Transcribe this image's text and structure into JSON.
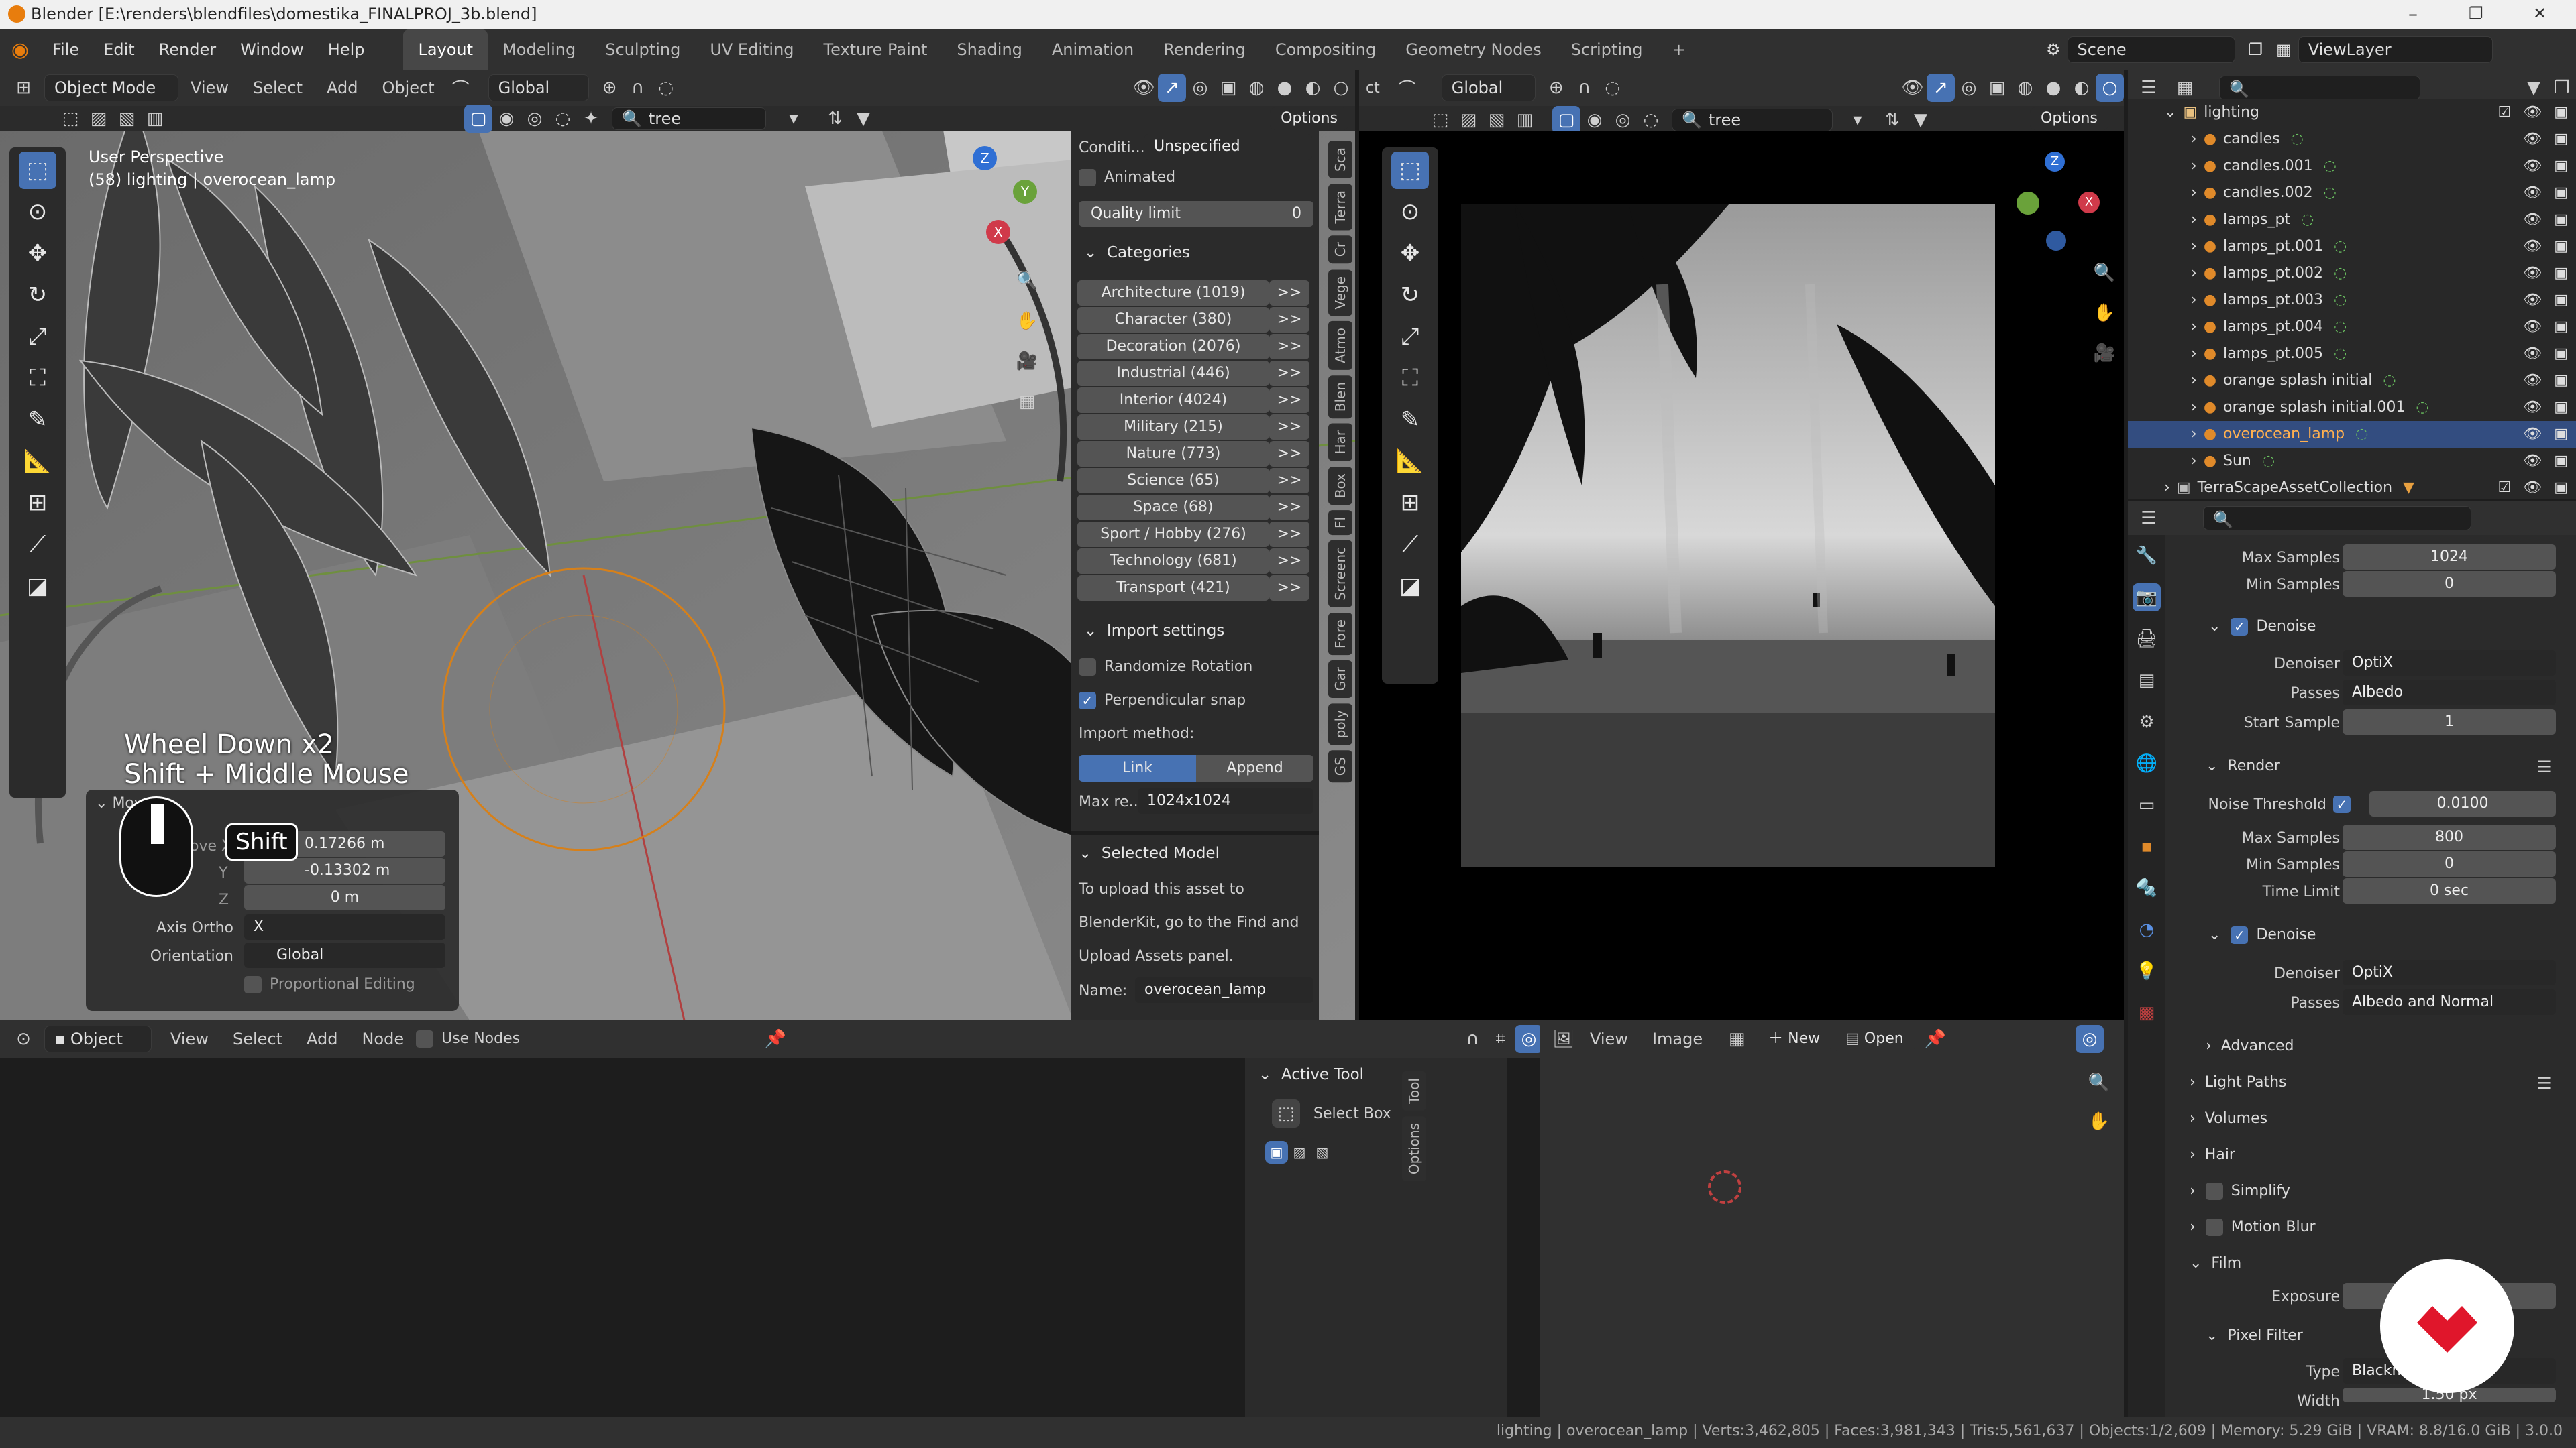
{
  "window": {
    "title": "Blender [E:\\renders\\blendfiles\\domestika_FINALPROJ_3b.blend]",
    "controls": [
      "–",
      "❐",
      "✕"
    ]
  },
  "menubar": {
    "menus": [
      "File",
      "Edit",
      "Render",
      "Window",
      "Help"
    ],
    "workspaces": [
      "Layout",
      "Modeling",
      "Sculpting",
      "UV Editing",
      "Texture Paint",
      "Shading",
      "Animation",
      "Rendering",
      "Compositing",
      "Geometry Nodes",
      "Scripting"
    ],
    "add_tab": "+",
    "scene": "Scene",
    "view_layer": "ViewLayer"
  },
  "viewport_left": {
    "mode": "Object Mode",
    "menus": [
      "View",
      "Select",
      "Add",
      "Object"
    ],
    "orientation": "Global",
    "search_value": "tree",
    "options_label": "Options",
    "perspective": "User Perspective",
    "collection_info": "(58) lighting | overocean_lamp",
    "key_hint_1": "Wheel Down x2",
    "key_hint_2": "Shift + Middle Mouse",
    "shift_badge": "Shift"
  },
  "move_panel": {
    "title": "Move",
    "move_x_label": "Move X",
    "x_value": "0.17266 m",
    "y_label": "Y",
    "y_value": "-0.13302 m",
    "z_label": "Z",
    "z_value": "0 m",
    "axis_ortho_label": "Axis Ortho",
    "axis_ortho_value": "X",
    "orientation_label": "Orientation",
    "orientation_value": "Global",
    "proportional_label": "Proportional Editing"
  },
  "blenderkit": {
    "condition_label": "Conditi...",
    "condition_value": "Unspecified",
    "animated_label": "Animated",
    "quality_label": "Quality limit",
    "quality_value": "0",
    "categories_header": "Categories",
    "categories": [
      "Architecture (1019)",
      "Character (380)",
      "Decoration (2076)",
      "Industrial (446)",
      "Interior (4024)",
      "Military (215)",
      "Nature (773)",
      "Science (65)",
      "Space (68)",
      "Sport / Hobby (276)",
      "Technology (681)",
      "Transport (421)"
    ],
    "arrow_label": ">>",
    "import_header": "Import settings",
    "randomize_label": "Randomize Rotation",
    "perp_snap_label": "Perpendicular snap",
    "import_method_label": "Import method:",
    "link_label": "Link",
    "append_label": "Append",
    "max_res_label": "Max re...",
    "max_res_value": "1024x1024",
    "selected_header": "Selected Model",
    "upload_text_1": "To upload this asset to",
    "upload_text_2": "BlenderKit, go to the Find and",
    "upload_text_3": "Upload Assets panel.",
    "name_label": "Name:",
    "name_value": "overocean_lamp"
  },
  "side_tabs": [
    "Sca",
    "Terra",
    "Cr",
    "Vege",
    "Atmo",
    "Blen",
    "Har",
    "Box",
    "Fl",
    "Screenc",
    "Fore",
    "Gar",
    "poly",
    "GS"
  ],
  "viewport_right": {
    "header_prefix": "ct",
    "orientation": "Global",
    "search_value": "tree",
    "options_label": "Options"
  },
  "node_editor": {
    "type": "Object",
    "menus": [
      "View",
      "Select",
      "Add",
      "Node"
    ],
    "use_nodes_label": "Use Nodes"
  },
  "active_tool": {
    "header": "Active Tool",
    "tool_name": "Select Box",
    "tabs": [
      "Tool",
      "Options"
    ]
  },
  "image_editor": {
    "menus": [
      "View",
      "Image"
    ],
    "new_label": "New",
    "open_label": "Open"
  },
  "outliner": {
    "root": "lighting",
    "items": [
      "candles",
      "candles.001",
      "candles.002",
      "lamps_pt",
      "lamps_pt.001",
      "lamps_pt.002",
      "lamps_pt.003",
      "lamps_pt.004",
      "lamps_pt.005",
      "orange splash initial",
      "orange splash initial.001",
      "overocean_lamp",
      "Sun"
    ],
    "selected": "overocean_lamp",
    "collection2": "TerraScapeAssetCollection"
  },
  "properties": {
    "max_samples_label": "Max Samples",
    "max_samples_value": "1024",
    "min_samples_label": "Min Samples",
    "min_samples_value": "0",
    "denoise_label": "Denoise",
    "denoiser_label": "Denoiser",
    "denoiser_value": "OptiX",
    "passes_label": "Passes",
    "passes_value": "Albedo",
    "start_sample_label": "Start Sample",
    "start_sample_value": "1",
    "render_label": "Render",
    "noise_threshold_label": "Noise Threshold",
    "noise_threshold_value": "0.0100",
    "render_max_samples_value": "800",
    "render_min_samples_value": "0",
    "time_limit_label": "Time Limit",
    "time_limit_value": "0 sec",
    "denoise2_label": "Denoise",
    "denoiser2_value": "OptiX",
    "passes2_value": "Albedo and Normal",
    "advanced_label": "Advanced",
    "light_paths_label": "Light Paths",
    "volumes_label": "Volumes",
    "hair_label": "Hair",
    "simplify_label": "Simplify",
    "motion_blur_label": "Motion Blur",
    "film_label": "Film",
    "exposure_label": "Exposure",
    "pixel_filter_label": "Pixel Filter",
    "type_label": "Type",
    "type_value": "Blackman",
    "width_label": "Width",
    "width_value": "1.50 px"
  },
  "statusbar": {
    "text": "lighting | overocean_lamp | Verts:3,462,805 | Faces:3,981,343 | Tris:5,561,637 | Objects:1/2,609 | Memory: 5.29 GiB | VRAM: 8.8/16.0 GiB | 3.0.0"
  },
  "colors": {
    "accent": "#4772b3",
    "selected_row": "#334d80",
    "brand_logo": "#e0162b"
  }
}
